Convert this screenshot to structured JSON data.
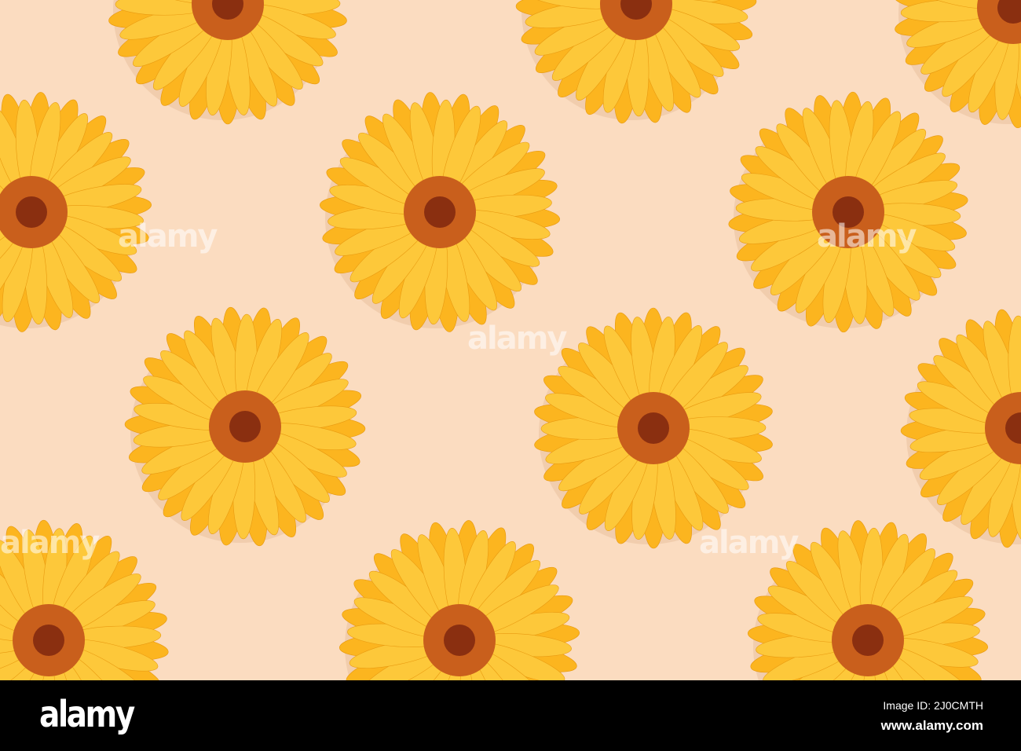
{
  "watermark": "alamy",
  "footer": {
    "logo": "alamy",
    "image_id": "Image ID: 2J0CMTH",
    "website": "www.alamy.com"
  },
  "colors": {
    "background": "#fbdcc0",
    "petal": "#fcb51f",
    "petal_light": "#fdc83a",
    "center": "#c95f1c",
    "center_dark": "#8a2f10"
  }
}
